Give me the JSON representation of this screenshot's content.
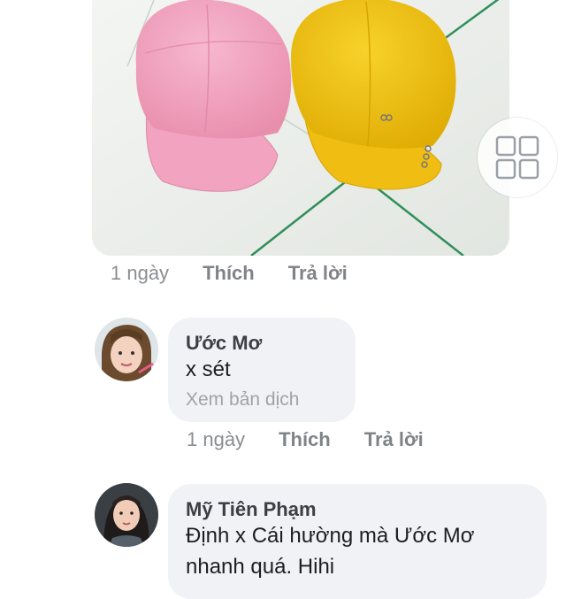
{
  "photo_comment": {
    "time": "1 ngày",
    "like_label": "Thích",
    "reply_label": "Trả lời",
    "gallery_icon": "grid-gallery-icon"
  },
  "comments": [
    {
      "author": "Ước Mơ",
      "text": "x sét",
      "translate_label": "Xem bản dịch",
      "time": "1 ngày",
      "like_label": "Thích",
      "reply_label": "Trả lời"
    },
    {
      "author": "Mỹ Tiên Phạm",
      "text_line1": "Định  x Cái  hường mà Ước Mơ",
      "text_line2": "nhanh quá. Hihi"
    }
  ],
  "colors": {
    "pink_cap": "#f4a9c3",
    "yellow_cap": "#f2c315",
    "tile_line": "#2f8f5a"
  }
}
